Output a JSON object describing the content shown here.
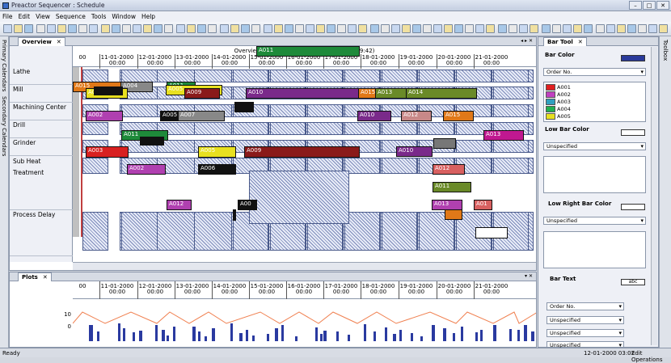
{
  "window": {
    "title": "Preactor Sequencer : Schedule"
  },
  "menu": [
    "File",
    "Edit",
    "View",
    "Sequence",
    "Tools",
    "Window",
    "Help"
  ],
  "left_tabs": [
    "Primary Calendars",
    "Secondary Calendars"
  ],
  "right_tabs": [
    "Toolbox"
  ],
  "overview": {
    "tab_label": "Overview",
    "title": "Overview  (10-01-2000 04:41 - 21-01-2000 19:42)",
    "dates": [
      {
        "d": "00",
        "t": ""
      },
      {
        "d": "11-01-2000",
        "t": "00:00"
      },
      {
        "d": "12-01-2000",
        "t": "00:00"
      },
      {
        "d": "13-01-2000",
        "t": "00:00"
      },
      {
        "d": "14-01-2000",
        "t": "00:00"
      },
      {
        "d": "15-01-2000",
        "t": "00:00"
      },
      {
        "d": "16-01-2000",
        "t": "00:00"
      },
      {
        "d": "17-01-2000",
        "t": "00:00"
      },
      {
        "d": "18-01-2000",
        "t": "00:00"
      },
      {
        "d": "19-01-2000",
        "t": "00:00"
      },
      {
        "d": "20-01-2000",
        "t": "00:00"
      },
      {
        "d": "21-01-2000",
        "t": "00:00"
      }
    ],
    "resources": [
      "Lathe",
      "Mill",
      "Machining Center",
      "Drill",
      "Grinder",
      "Sub Heat Treatment",
      "Process Delay"
    ],
    "bars": [
      {
        "label": "A011",
        "color": "#1e8a3a"
      },
      {
        "label": "A015",
        "color": "#e07818"
      },
      {
        "label": "A004",
        "color": "#888888"
      },
      {
        "label": "A011",
        "color": "#1e8a3a"
      },
      {
        "label": "A005",
        "color": "#e8e020"
      },
      {
        "label": "A005",
        "color": "#e8e020"
      },
      {
        "label": "A009",
        "color": "#8a1a1a"
      },
      {
        "label": "A010",
        "color": "#7a2a8a"
      },
      {
        "label": "A015",
        "color": "#e07818"
      },
      {
        "label": "A013",
        "color": "#6a8a28"
      },
      {
        "label": "A014",
        "color": "#6a8a28"
      },
      {
        "label": "A002",
        "color": "#b040b0"
      },
      {
        "label": "A005",
        "color": "#111111"
      },
      {
        "label": "A007",
        "color": "#888888"
      },
      {
        "label": "A010",
        "color": "#7a2a8a"
      },
      {
        "label": "A012",
        "color": "#c88888"
      },
      {
        "label": "A015",
        "color": "#e07818"
      },
      {
        "label": "A011",
        "color": "#1e8a3a"
      },
      {
        "label": "A013",
        "color": "#c01890"
      },
      {
        "label": "A003",
        "color": "#d82020"
      },
      {
        "label": "A005",
        "color": "#e8e020"
      },
      {
        "label": "A009",
        "color": "#8a1a1a"
      },
      {
        "label": "A010",
        "color": "#7a2a8a"
      },
      {
        "label": "A002",
        "color": "#b040b0"
      },
      {
        "label": "A006",
        "color": "#111111"
      },
      {
        "label": "A012",
        "color": "#d86060"
      },
      {
        "label": "A011",
        "color": "#6a8a28"
      },
      {
        "label": "A012",
        "color": "#b040b0"
      },
      {
        "label": "A00",
        "color": "#111111"
      },
      {
        "label": "A013",
        "color": "#b040b0"
      },
      {
        "label": "A01",
        "color": "#d86060"
      }
    ]
  },
  "plots": {
    "tab_label": "Plots",
    "dates": [
      {
        "d": "00",
        "t": ""
      },
      {
        "d": "11-01-2000",
        "t": "00:00"
      },
      {
        "d": "12-01-2000",
        "t": "00:00"
      },
      {
        "d": "13-01-2000",
        "t": "00:00"
      },
      {
        "d": "14-01-2000",
        "t": "00:00"
      },
      {
        "d": "15-01-2000",
        "t": "00:00"
      },
      {
        "d": "16-01-2000",
        "t": "00:00"
      },
      {
        "d": "17-01-2000",
        "t": "00:00"
      },
      {
        "d": "18-01-2000",
        "t": "00:00"
      },
      {
        "d": "19-01-2000",
        "t": "00:00"
      },
      {
        "d": "20-01-2000",
        "t": "00:00"
      },
      {
        "d": "21-01-2000",
        "t": "00:00"
      }
    ],
    "y_ticks": [
      "10",
      "0"
    ]
  },
  "bar_tool": {
    "tab_label": "Bar Tool",
    "bar_color_label": "Bar Color",
    "bar_color_select": "Order No.",
    "order_items": [
      {
        "label": "A001",
        "color": "#e02020"
      },
      {
        "label": "A002",
        "color": "#c040c0"
      },
      {
        "label": "A003",
        "color": "#30a0c0"
      },
      {
        "label": "A004",
        "color": "#20b050"
      },
      {
        "label": "A005",
        "color": "#e8e020"
      }
    ],
    "low_bar_color_label": "Low Bar Color",
    "low_bar_color_select": "Unspecified",
    "low_right_label": "Low Right Bar Color",
    "low_right_select": "Unspecified",
    "bar_text_label": "Bar Text",
    "bar_text_swatch": "abc",
    "bar_text_selects": [
      "Order No.",
      "Unspecified",
      "Unspecified",
      "Unspecified"
    ]
  },
  "status": {
    "left": "Ready",
    "datetime": "12-01-2000 03:02",
    "mode": "Edit Operations"
  }
}
